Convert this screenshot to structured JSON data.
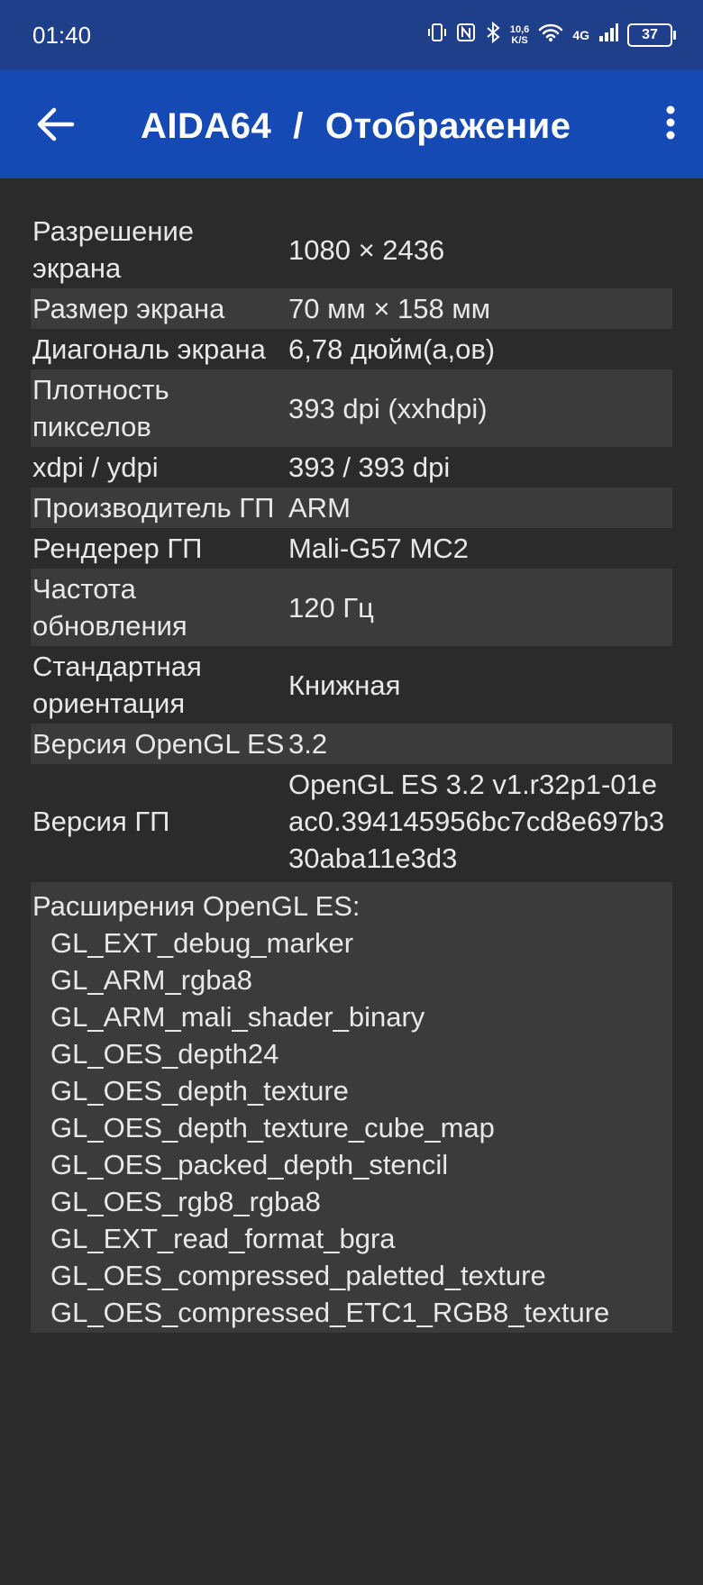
{
  "status_bar": {
    "time": "01:40",
    "speed_value": "10,6",
    "speed_unit": "K/S",
    "network": "4G",
    "battery": "37"
  },
  "app_bar": {
    "app_name": "AIDA64",
    "separator": "/",
    "section": "Отображение",
    "icons": [
      "arrow-back-icon",
      "more-vert-icon"
    ]
  },
  "rows": [
    {
      "label": "Разрешение экрана",
      "value": "1080 × 2436"
    },
    {
      "label": "Размер экрана",
      "value": "70 мм × 158 мм"
    },
    {
      "label": "Диагональ экрана",
      "value": "6,78 дюйм(а,ов)"
    },
    {
      "label": "Плотность пикселов",
      "value": "393 dpi (xxhdpi)"
    },
    {
      "label": "xdpi / ydpi",
      "value": "393 / 393 dpi"
    },
    {
      "label": "Производитель ГП",
      "value": "ARM"
    },
    {
      "label": "Рендерер ГП",
      "value": "Mali-G57 MC2"
    },
    {
      "label": "Частота обновления",
      "value": "120 Гц"
    },
    {
      "label": "Стандартная ориентация",
      "value": "Книжная"
    },
    {
      "label": "Версия OpenGL ES",
      "value": "3.2"
    },
    {
      "label": "Версия ГП",
      "value": "OpenGL ES 3.2 v1.r32p1-01eac0.394145956bc7cd8e697b330aba11e3d3"
    }
  ],
  "extensions": {
    "title": "Расширения OpenGL ES:",
    "items": [
      "GL_EXT_debug_marker",
      "GL_ARM_rgba8",
      "GL_ARM_mali_shader_binary",
      "GL_OES_depth24",
      "GL_OES_depth_texture",
      "GL_OES_depth_texture_cube_map",
      "GL_OES_packed_depth_stencil",
      "GL_OES_rgb8_rgba8",
      "GL_EXT_read_format_bgra",
      "GL_OES_compressed_paletted_texture",
      "GL_OES_compressed_ETC1_RGB8_texture"
    ]
  },
  "colors": {
    "status_bar": "#1f3f8a",
    "app_bar": "#1549b3",
    "background": "#2b2b2b",
    "row_shade": "#3b3b3b"
  }
}
